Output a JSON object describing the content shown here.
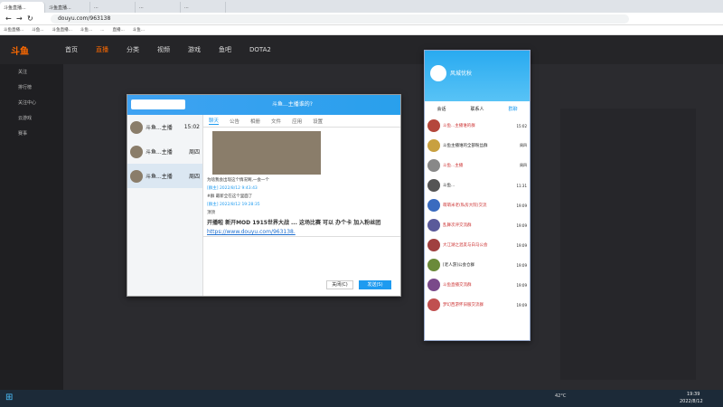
{
  "browser": {
    "tabs": [
      "斗鱼直播...",
      "斗鱼直播...",
      "...",
      "...",
      "...",
      "...",
      "...",
      "...",
      "..."
    ],
    "url": "douyu.com/963138",
    "bookmarks": [
      "斗鱼直播...",
      "斗鱼...",
      "斗鱼直播...",
      "斗鱼...",
      "...",
      "直播...",
      "斗鱼...",
      "...",
      "...",
      "...",
      "...",
      "...",
      "...",
      "...",
      "..."
    ]
  },
  "site": {
    "logo": "斗鱼",
    "nav": [
      "首页",
      "直播",
      "分类",
      "视频",
      "游戏",
      "鱼吧",
      "DOTA2"
    ]
  },
  "sidebar": [
    "关注",
    "排行榜",
    "关注中心",
    "云游戏",
    "赛事"
  ],
  "qq_chat": {
    "title": "斗鱼...主播谁的?",
    "tabs": [
      "聊天",
      "公告",
      "相册",
      "文件",
      "应用",
      "设置"
    ],
    "conversations": [
      {
        "name": "斗鱼...主播",
        "time": "15:02"
      },
      {
        "name": "斗鱼...主播",
        "time": "周四"
      },
      {
        "name": "斗鱼...主播",
        "time": "周四"
      }
    ],
    "messages": [
      "为啥我会出现这个情况啊,一会一个",
      "[群主] 2022/8/12 9:43:43",
      "#群 最新全在这个里面了",
      "[群主] 2022/8/12 19:28:35",
      "顶顶",
      "开播啦 新开MOD 1915世界大战 ... 这场比赛 可以 办个卡 加入粉丝团",
      "https://www.douyu.com/963138."
    ],
    "buttons": {
      "close": "关闭(C)",
      "send": "发送(S)"
    }
  },
  "qq_main": {
    "username": "风城忧秋",
    "tabs": [
      "会话",
      "联系人",
      "群聊"
    ],
    "groups": [
      {
        "name": "斗鱼...主播谁的群",
        "time": "15:02",
        "color": "#b4473c"
      },
      {
        "name": "斗鱼主播谁的全部粉丝群",
        "time": "周四",
        "color": "#c8a040"
      },
      {
        "name": "斗鱼...主播",
        "time": "周四",
        "color": "#888"
      },
      {
        "name": "斗鱼...",
        "time": "11:31",
        "color": "#555"
      },
      {
        "name": "萌萌米老(私房大院)交流",
        "time": "19:09",
        "color": "#3a6bbf"
      },
      {
        "name": "乱舞次评交流群",
        "time": "19:09",
        "color": "#5a5a9a"
      },
      {
        "name": "大江湖之混友与白马公会",
        "time": "19:09",
        "color": "#a04040"
      },
      {
        "name": "[老人游]公会仓群",
        "time": "19:09",
        "color": "#6a8a3a"
      },
      {
        "name": "斗鱼直播交流群",
        "time": "19:09",
        "color": "#7a4a8a"
      },
      {
        "name": "梦幻西游怀旧服交流群",
        "time": "19:09",
        "color": "#c05050"
      }
    ]
  },
  "taskbar": {
    "time": "19:39",
    "date": "2022/8/12",
    "temp": "42°C"
  }
}
